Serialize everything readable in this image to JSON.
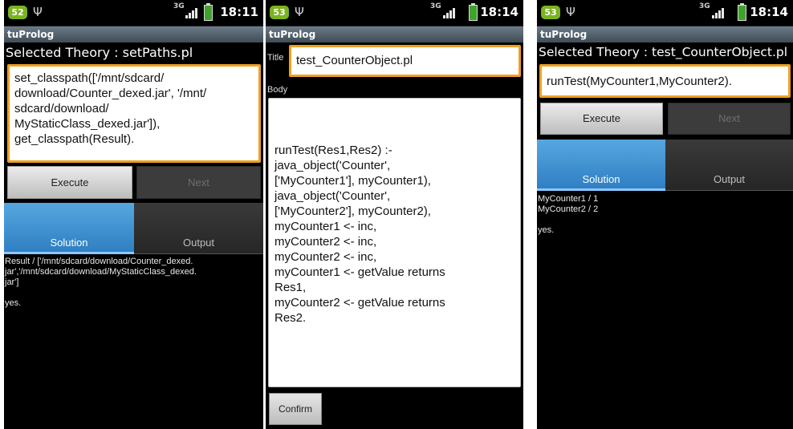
{
  "screens": [
    {
      "status": {
        "badge": "52",
        "network": "3G",
        "clock": "18:11"
      },
      "app_title": "tuProlog",
      "theory_label": "Selected Theory : setPaths.pl",
      "query": "set_classpath(['/mnt/sdcard/\ndownload/Counter_dexed.jar', '/mnt/\nsdcard/download/\nMyStaticClass_dexed.jar']),\nget_classpath(Result).",
      "execute_label": "Execute",
      "next_label": "Next",
      "tab_solution": "Solution",
      "tab_output": "Output",
      "result": "Result / ['/mnt/sdcard/download/Counter_dexed.\njar','/mnt/sdcard/download/MyStaticClass_dexed.\njar']\n\nyes."
    },
    {
      "status": {
        "badge": "53",
        "network": "3G",
        "clock": "18:14"
      },
      "app_title": "tuProlog",
      "title_label": "Title",
      "title_value": "test_CounterObject.pl",
      "body_label": "Body",
      "body_text": "runTest(Res1,Res2) :-\njava_object('Counter',\n['MyCounter1'], myCounter1),\njava_object('Counter',\n['MyCounter2'], myCounter2),\nmyCounter1 <- inc,\nmyCounter2 <- inc,\nmyCounter2 <- inc,\nmyCounter1 <- getValue returns\nRes1,\nmyCounter2 <- getValue returns\nRes2.",
      "confirm_label": "Confirm"
    },
    {
      "status": {
        "badge": "53",
        "network": "3G",
        "clock": "18:14"
      },
      "app_title": "tuProlog",
      "theory_label": "Selected Theory : test_CounterObject.pl",
      "query": "runTest(MyCounter1,MyCounter2).",
      "execute_label": "Execute",
      "next_label": "Next",
      "tab_solution": "Solution",
      "tab_output": "Output",
      "result": "MyCounter1 / 1\nMyCounter2 / 2\n\nyes."
    }
  ],
  "colors": {
    "accent": "#f0a020",
    "tab_selected": "#3d8fd0",
    "badge": "#7ab321"
  }
}
